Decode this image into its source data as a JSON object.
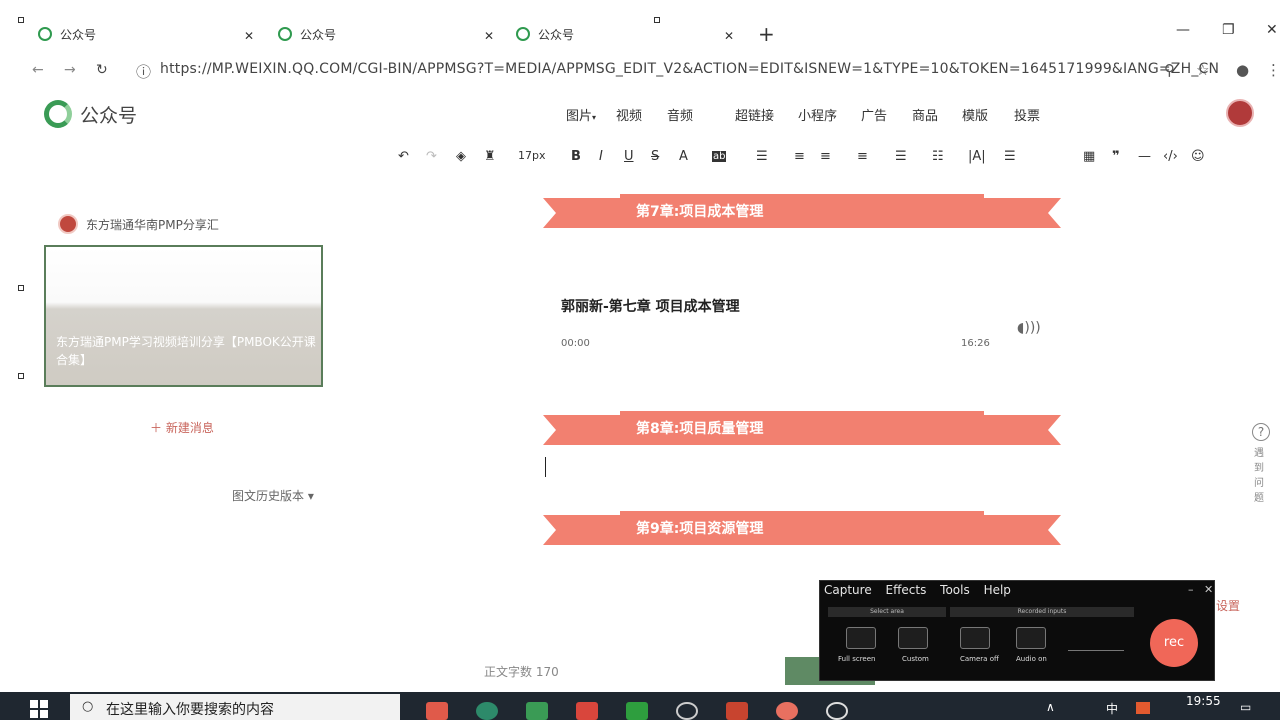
{
  "browser": {
    "tabs": [
      {
        "title": "公众号"
      },
      {
        "title": "公众号"
      },
      {
        "title": "公众号"
      }
    ],
    "new_tab": "+",
    "url": "https://mp.weixin.qq.com/cgi-bin/appmsg?t=media/appmsg_edit_v2&action=edit&isNew=1&type=10&token=1645171999&lang=zh_CN",
    "url_display": "https://MP.WEIXIN.QQ.COM/CGI-BIN/APPMSG?T=MEDIA/APPMSG_EDIT_V2&ACTION=EDIT&ISNEW=1&TYPE=10&TOKEN=1645171999&IANG=ZH_CN"
  },
  "header": {
    "logo_text": "公众号",
    "menu": [
      "图片",
      "视频",
      "音频",
      "超链接",
      "小程序",
      "广告",
      "商品",
      "模版",
      "投票"
    ],
    "image_menu_arrow": "▾"
  },
  "toolbar": {
    "font_size": "17px"
  },
  "sidebar": {
    "account_name": "东方瑞通华南PMP分享汇",
    "card_title": "东方瑞通PMP学习视频培训分享【PMBOK公开课合集】",
    "new_article": "新建消息",
    "history": "图文历史版本 ▾"
  },
  "editor": {
    "banners": [
      "第7章:项目成本管理",
      "第8章:项目质量管理",
      "第9章:项目资源管理"
    ],
    "audio": {
      "title": "郭丽新-第七章 项目成本管理",
      "start_time": "00:00",
      "end_time": "16:26"
    },
    "word_count": "正文字数 170"
  },
  "right_panel": {
    "help": "?",
    "feedback": "遇到问题",
    "settings": "设置"
  },
  "recorder": {
    "menu": [
      "Capture",
      "Effects",
      "Tools",
      "Help"
    ],
    "sections": [
      "Select area",
      "Recorded inputs"
    ],
    "devices": [
      "Full screen",
      "Custom",
      "Camera off",
      "Audio on"
    ],
    "rec_button": "rec"
  },
  "taskbar": {
    "search_placeholder": "在这里输入你要搜索的内容",
    "ime": "中",
    "time": "19:55"
  },
  "colors": {
    "banner": "#f28070",
    "accent_green": "#3a9b55",
    "rec_red": "#f06758"
  }
}
